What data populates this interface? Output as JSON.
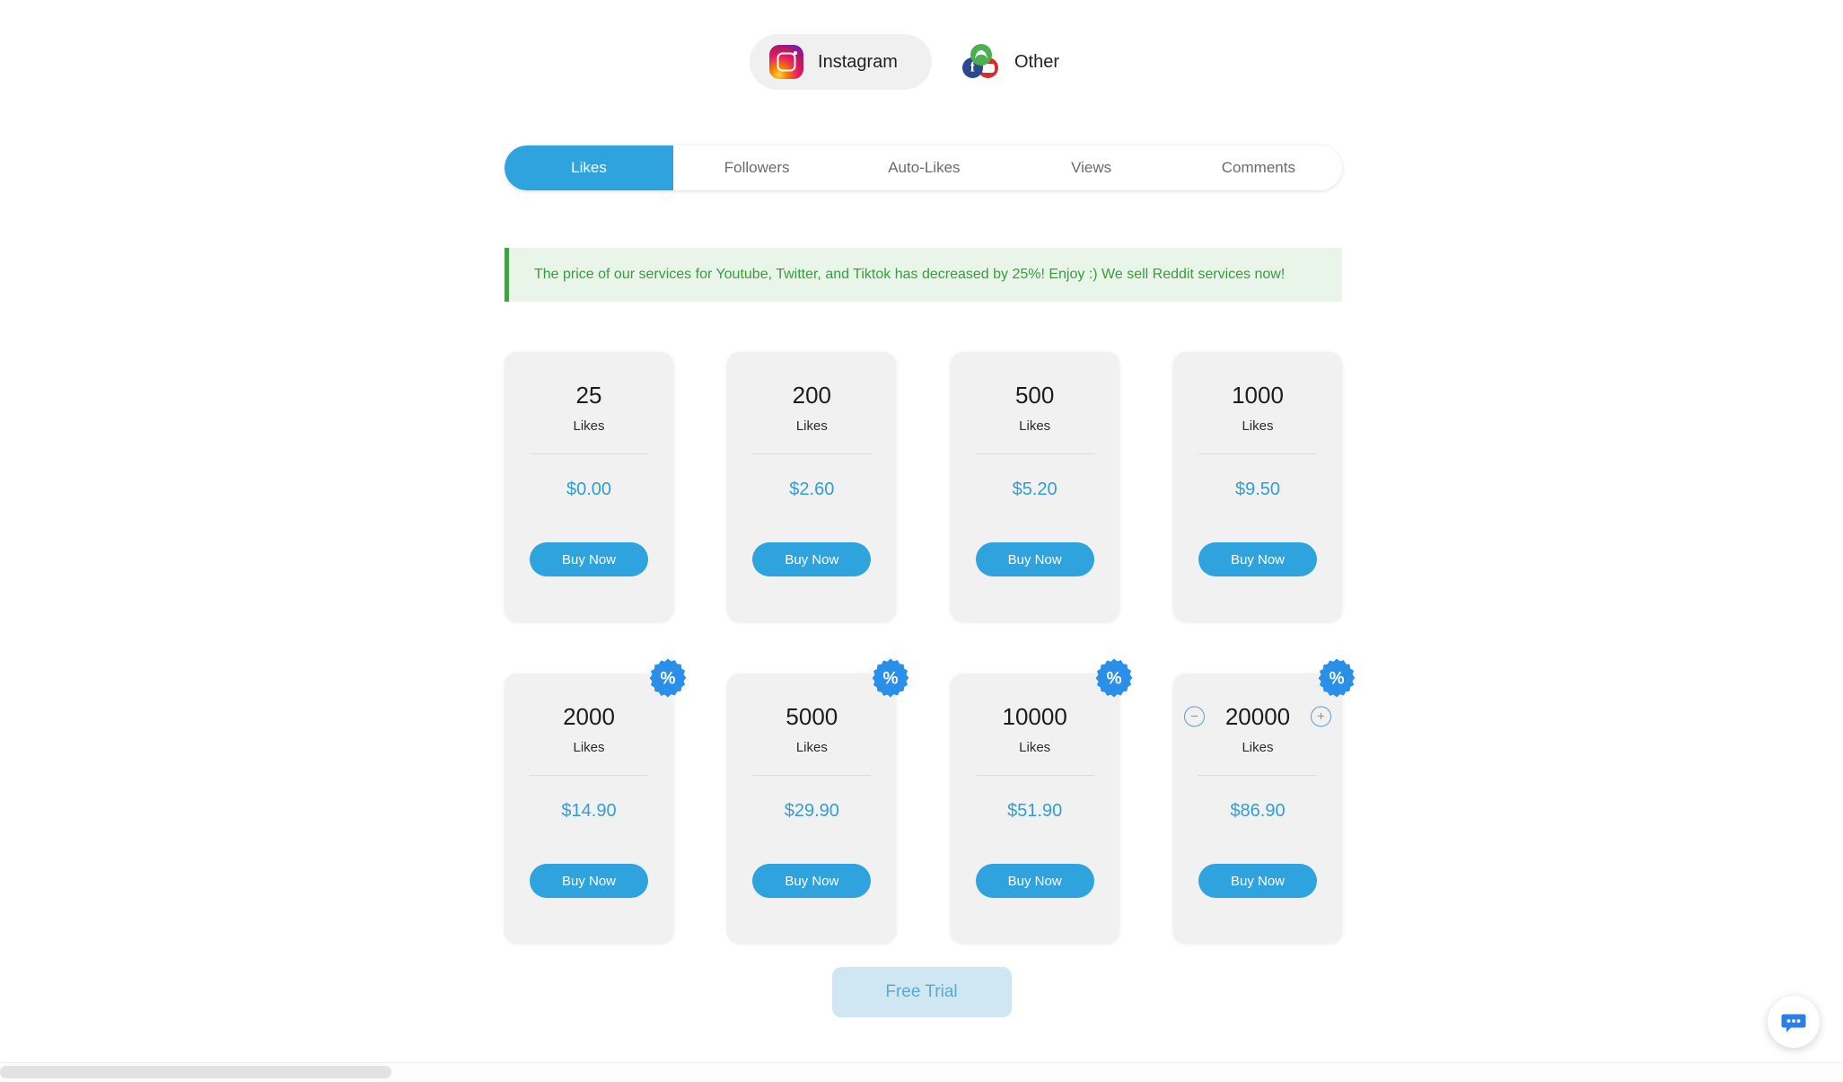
{
  "platforms": [
    {
      "id": "instagram",
      "label": "Instagram",
      "icon": "instagram-icon",
      "selected": true
    },
    {
      "id": "other",
      "label": "Other",
      "icon": "other-platforms-icon",
      "selected": false
    }
  ],
  "tabs": [
    {
      "label": "Likes",
      "active": true
    },
    {
      "label": "Followers",
      "active": false
    },
    {
      "label": "Auto-Likes",
      "active": false
    },
    {
      "label": "Views",
      "active": false
    },
    {
      "label": "Comments",
      "active": false
    }
  ],
  "announcement": {
    "text": "The price of our services for Youtube, Twitter, and Tiktok has decreased by 25%! Enjoy :) We sell Reddit services now!",
    "accent_color": "#43a047",
    "background_color": "#e9f5e9"
  },
  "packages": [
    {
      "quantity": "25",
      "unit": "Likes",
      "price": "$0.00",
      "buy_label": "Buy Now",
      "discount": false,
      "stepper": false
    },
    {
      "quantity": "200",
      "unit": "Likes",
      "price": "$2.60",
      "buy_label": "Buy Now",
      "discount": false,
      "stepper": false
    },
    {
      "quantity": "500",
      "unit": "Likes",
      "price": "$5.20",
      "buy_label": "Buy Now",
      "discount": false,
      "stepper": false
    },
    {
      "quantity": "1000",
      "unit": "Likes",
      "price": "$9.50",
      "buy_label": "Buy Now",
      "discount": false,
      "stepper": false
    },
    {
      "quantity": "2000",
      "unit": "Likes",
      "price": "$14.90",
      "buy_label": "Buy Now",
      "discount": true,
      "stepper": false
    },
    {
      "quantity": "5000",
      "unit": "Likes",
      "price": "$29.90",
      "buy_label": "Buy Now",
      "discount": true,
      "stepper": false
    },
    {
      "quantity": "10000",
      "unit": "Likes",
      "price": "$51.90",
      "buy_label": "Buy Now",
      "discount": true,
      "stepper": false
    },
    {
      "quantity": "20000",
      "unit": "Likes",
      "price": "$86.90",
      "buy_label": "Buy Now",
      "discount": true,
      "stepper": true
    }
  ],
  "discount_badge": {
    "symbol": "%",
    "color": "#2a8fe8"
  },
  "stepper": {
    "decrease_label": "−",
    "increase_label": "+"
  },
  "free_trial": {
    "label": "Free Trial"
  },
  "chat": {
    "icon": "chat-bubble-icon",
    "color": "#2a7fe8"
  },
  "colors": {
    "accent": "#2fa3dd",
    "price": "#2f9fd6",
    "card_bg": "#f1f1f1",
    "page_bg": "#ffffff"
  }
}
